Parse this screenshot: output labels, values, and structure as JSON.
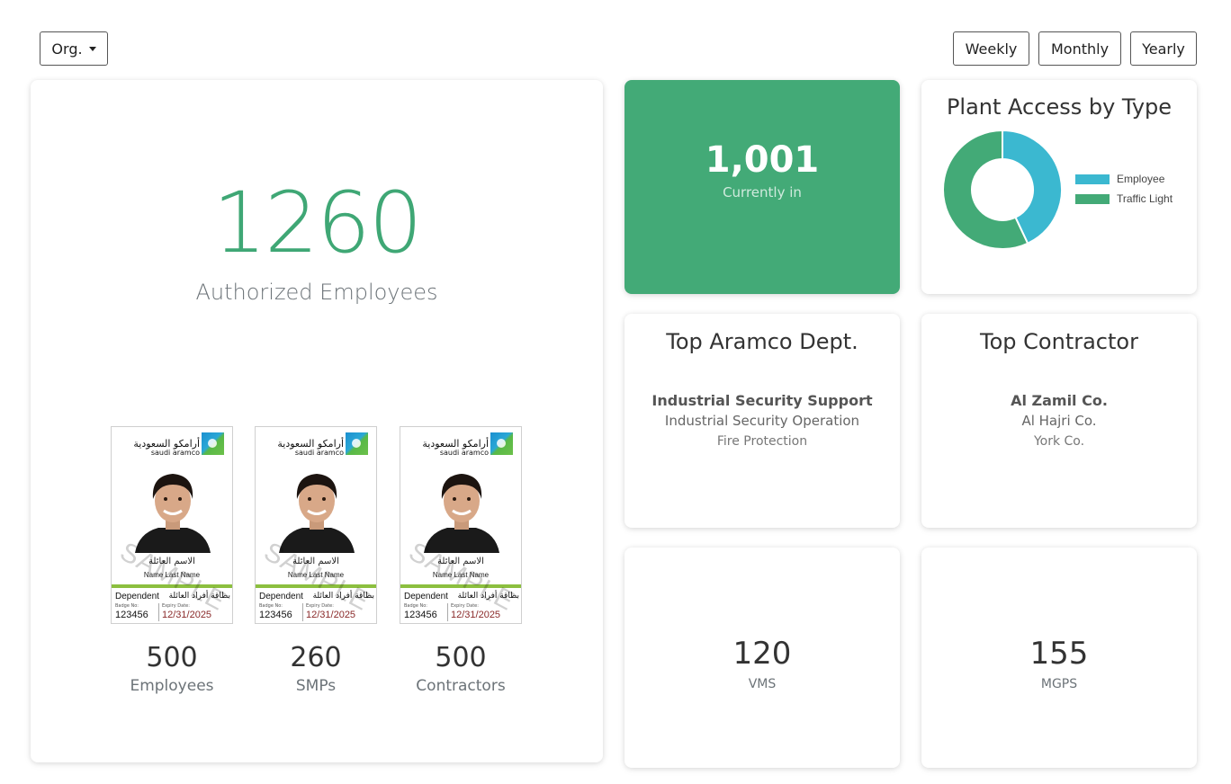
{
  "toolbar": {
    "org_label": "Org.",
    "weekly_label": "Weekly",
    "monthly_label": "Monthly",
    "yearly_label": "Yearly"
  },
  "authorized": {
    "count": "1260",
    "label": "Authorized Employees"
  },
  "badges": [
    {
      "count": "500",
      "label": "Employees"
    },
    {
      "count": "260",
      "label": "SMPs"
    },
    {
      "count": "500",
      "label": "Contractors"
    }
  ],
  "badge_card": {
    "logo_ar": "أرامكو السعودية",
    "logo_en": "saudi aramco",
    "name_ar": "الاسم العائلة",
    "name_en": "Name Last Name",
    "type_en": "Dependent",
    "type_ar": "بطاقة أفراد العائلة",
    "badge_no_label": "Badge No:",
    "badge_no": "123456",
    "expiry_label": "Expiry Date:",
    "expiry": "12/31/2025",
    "watermark": "SAMPLE"
  },
  "currently_in": {
    "count": "1,001",
    "label": "Currently in"
  },
  "plant_access": {
    "title": "Plant Access by Type"
  },
  "top_dept": {
    "title": "Top Aramco Dept.",
    "items": [
      "Industrial Security Support",
      "Industrial Security Operation",
      "Fire Protection"
    ]
  },
  "top_contractor": {
    "title": "Top Contractor",
    "items": [
      "Al Zamil Co.",
      "Al Hajri Co.",
      "York Co."
    ]
  },
  "vms": {
    "count": "120",
    "label": "VMS"
  },
  "mgps": {
    "count": "155",
    "label": "MGPS"
  },
  "chart_data": {
    "type": "pie",
    "donut": true,
    "title": "Plant Access by Type",
    "categories": [
      "Employee",
      "Traffic Light"
    ],
    "values": [
      43,
      57
    ],
    "colors": [
      "#3bb8d0",
      "#43aa77"
    ],
    "legend_position": "right"
  },
  "colors": {
    "accent_green": "#43aa77",
    "accent_cyan": "#3bb8d0",
    "badge_stripe": "#8cbf3f"
  }
}
